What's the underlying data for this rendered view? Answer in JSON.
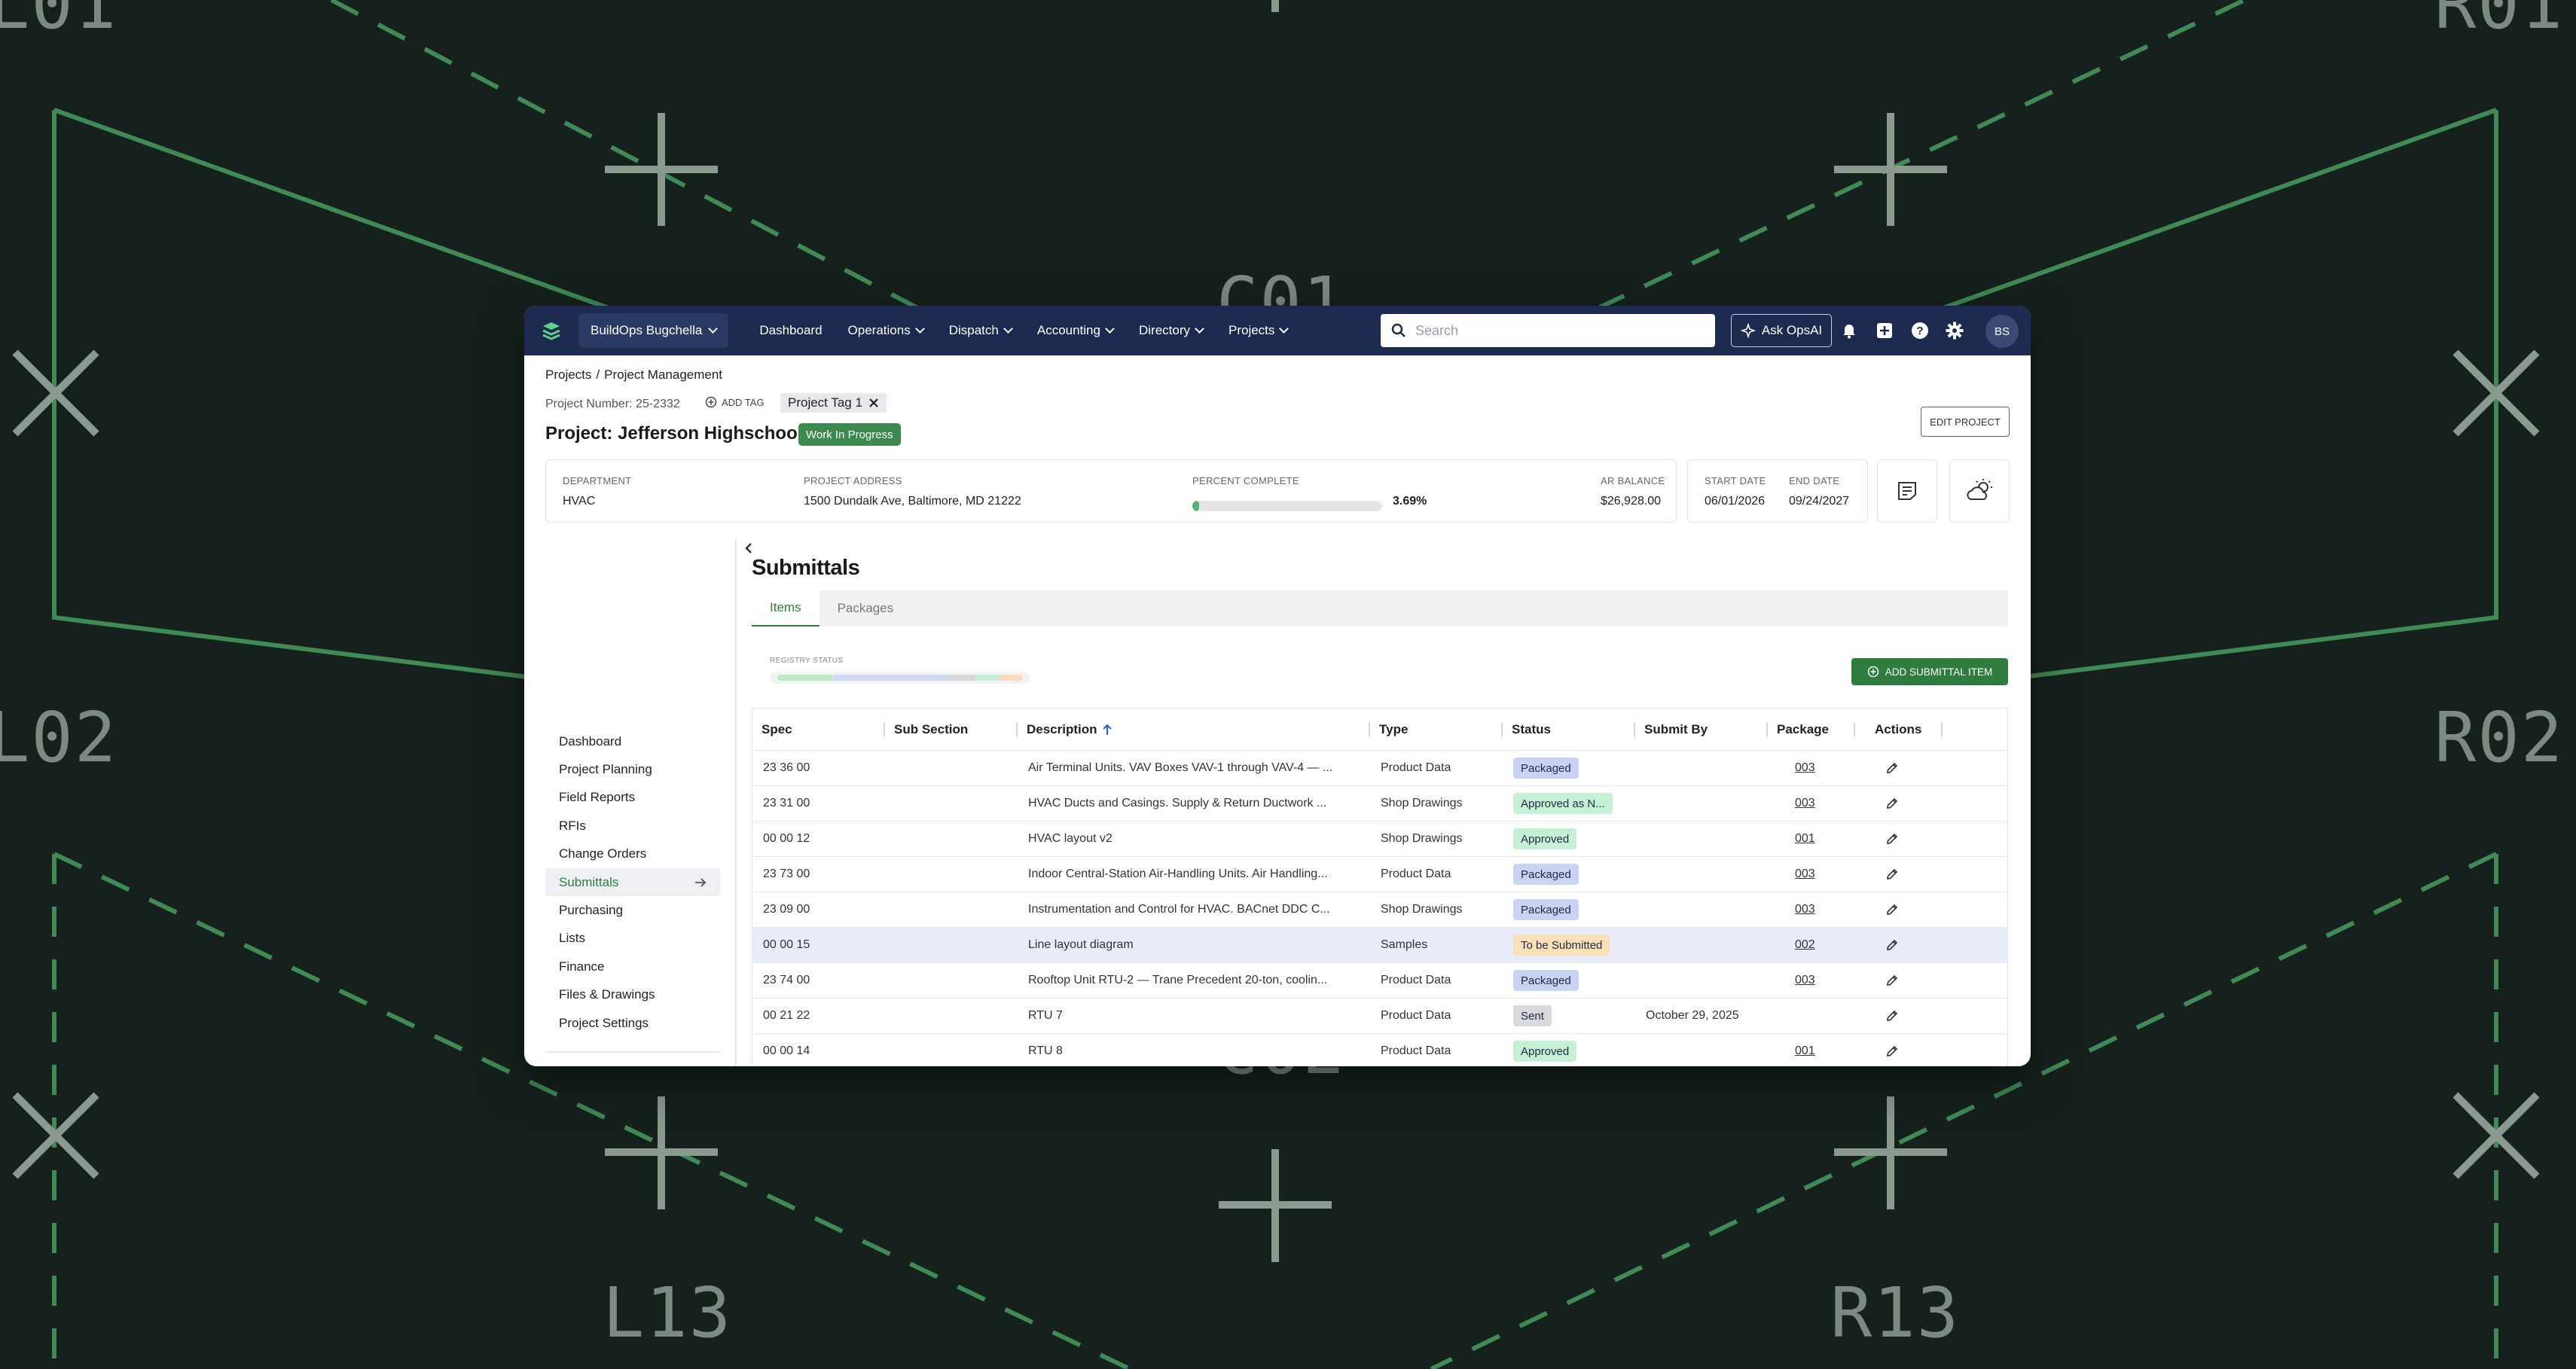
{
  "background": {
    "labels": [
      "L01",
      "R01",
      "C01",
      "L02",
      "R02",
      "C02",
      "L13",
      "R13"
    ]
  },
  "nav": {
    "company": "BuildOps Bugchella",
    "items": [
      "Dashboard",
      "Operations",
      "Dispatch",
      "Accounting",
      "Directory",
      "Projects"
    ],
    "search_placeholder": "Search",
    "ask_label": "Ask OpsAI",
    "avatar_initials": "BS"
  },
  "breadcrumb": {
    "root": "Projects",
    "sep": "/",
    "current": "Project Management"
  },
  "project": {
    "number": "Project Number: 25-2332",
    "add_tag": "ADD TAG",
    "tag": "Project Tag 1",
    "title": "Project: Jefferson Highschool",
    "status": "Work In Progress",
    "edit_label": "EDIT PROJECT",
    "department_label": "DEPARTMENT",
    "department": "HVAC",
    "address_label": "PROJECT ADDRESS",
    "address": "1500 Dundalk Ave, Baltimore, MD 21222",
    "percent_label": "PERCENT COMPLETE",
    "percent_text": "3.69%",
    "percent_value": 3.69,
    "ar_label": "AR BALANCE",
    "ar_balance": "$26,928.00",
    "start_label": "START DATE",
    "start_date": "06/01/2026",
    "end_label": "END DATE",
    "end_date": "09/24/2027"
  },
  "sidebar": {
    "items": [
      "Dashboard",
      "Project Planning",
      "Field Reports",
      "RFIs",
      "Change Orders",
      "Submittals",
      "Purchasing",
      "Lists",
      "Finance",
      "Files & Drawings",
      "Project Settings"
    ],
    "active": "Submittals"
  },
  "submittals": {
    "title": "Submittals",
    "tabs": [
      "Items",
      "Packages"
    ],
    "registry_label": "REGISTRY STATUS",
    "add_label": "ADD SUBMITTAL ITEM",
    "columns": [
      "Spec",
      "Sub Section",
      "Description",
      "Type",
      "Status",
      "Submit By",
      "Package",
      "Actions"
    ],
    "rows": [
      {
        "spec": "23 36 00",
        "sub": "",
        "desc": "Air Terminal Units. VAV Boxes VAV-1 through VAV-4 — ...",
        "type": "Product Data",
        "status": "Packaged",
        "submit_by": "",
        "package": "003"
      },
      {
        "spec": "23 31 00",
        "sub": "",
        "desc": "HVAC Ducts and Casings. Supply & Return Ductwork ...",
        "type": "Shop Drawings",
        "status": "Approved as N...",
        "submit_by": "",
        "package": "003"
      },
      {
        "spec": "00 00 12",
        "sub": "",
        "desc": "HVAC layout v2",
        "type": "Shop Drawings",
        "status": "Approved",
        "submit_by": "",
        "package": "001"
      },
      {
        "spec": "23 73 00",
        "sub": "",
        "desc": "Indoor Central-Station Air-Handling Units. Air Handling...",
        "type": "Product Data",
        "status": "Packaged",
        "submit_by": "",
        "package": "003"
      },
      {
        "spec": "23 09 00",
        "sub": "",
        "desc": "Instrumentation and Control for HVAC. BACnet DDC C...",
        "type": "Shop Drawings",
        "status": "Packaged",
        "submit_by": "",
        "package": "003"
      },
      {
        "spec": "00 00 15",
        "sub": "",
        "desc": "Line layout diagram",
        "type": "Samples",
        "status": "To be Submitted",
        "submit_by": "",
        "package": "002"
      },
      {
        "spec": "23 74 00",
        "sub": "",
        "desc": "Rooftop Unit RTU-2 — Trane Precedent 20-ton, coolin...",
        "type": "Product Data",
        "status": "Packaged",
        "submit_by": "",
        "package": "003"
      },
      {
        "spec": "00 21 22",
        "sub": "",
        "desc": "RTU 7",
        "type": "Product Data",
        "status": "Sent",
        "submit_by": "October 29, 2025",
        "package": ""
      },
      {
        "spec": "00 00 14",
        "sub": "",
        "desc": "RTU 8",
        "type": "Product Data",
        "status": "Approved",
        "submit_by": "",
        "package": "001"
      }
    ]
  },
  "colors": {
    "nav_bg": "#1d2a4f",
    "accent_green": "#2e7d3f",
    "status_packaged": "#c9d3f3",
    "status_approved": "#c6f0d4",
    "status_to_be_submitted": "#fde0b8",
    "status_sent": "#d7d9dc",
    "background": "#16211d",
    "background_lines": "#3f8a55"
  }
}
